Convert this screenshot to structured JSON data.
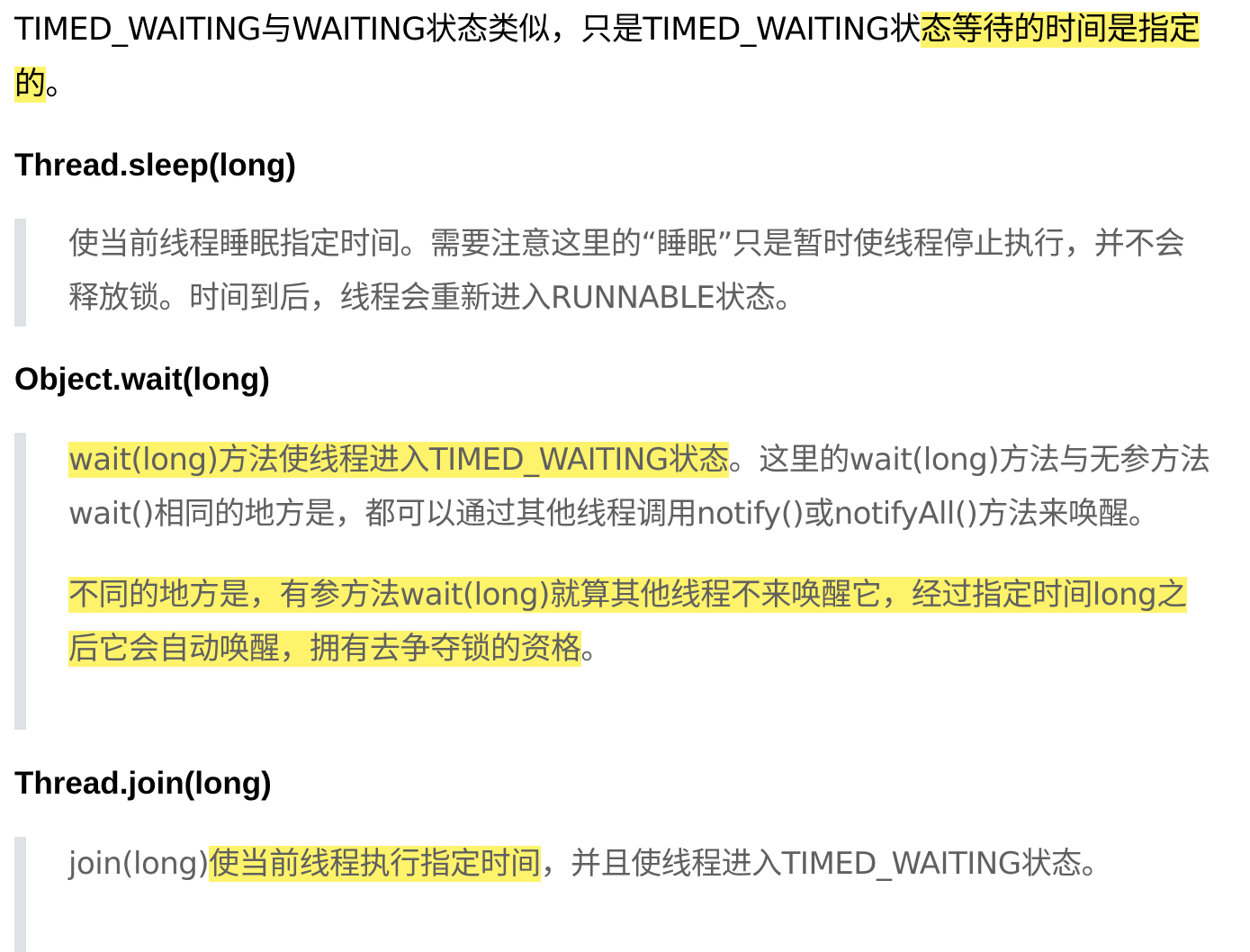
{
  "intro": {
    "part1": "TIMED_WAITING与WAITING状态类似，只是TIMED_WAITING状",
    "highlight": "态等待的时间是指定的",
    "part2": "。"
  },
  "sections": [
    {
      "heading": "Thread.sleep(long)",
      "quote": {
        "text": "使当前线程睡眠指定时间。需要注意这里的“睡眠”只是暂时使线程停止执行，并不会释放锁。时间到后，线程会重新进入RUNNABLE状态。"
      }
    },
    {
      "heading": "Object.wait(long)",
      "quote": {
        "p1_highlight": "wait(long)方法使线程进入TIMED_WAITING状态",
        "p1_rest": "。这里的wait(long)方法与无参方法wait()相同的地方是，都可以通过其他线程调用notify()或notifyAll()方法来唤醒。",
        "p2_highlight": "不同的地方是，有参方法wait(long)就算其他线程不来唤醒它，经过指定时间long之后它会自动唤醒，拥有去争夺锁的资格",
        "p2_rest": "。"
      }
    },
    {
      "heading": "Thread.join(long)",
      "quote": {
        "lead": "join(long)",
        "highlight": "使当前线程执行指定时间",
        "rest": "，并且使线程进入TIMED_WAITING状态。"
      }
    }
  ],
  "colors": {
    "highlight": "#fff36b",
    "quote_border": "#dfe2e5",
    "quote_text": "#606060"
  }
}
